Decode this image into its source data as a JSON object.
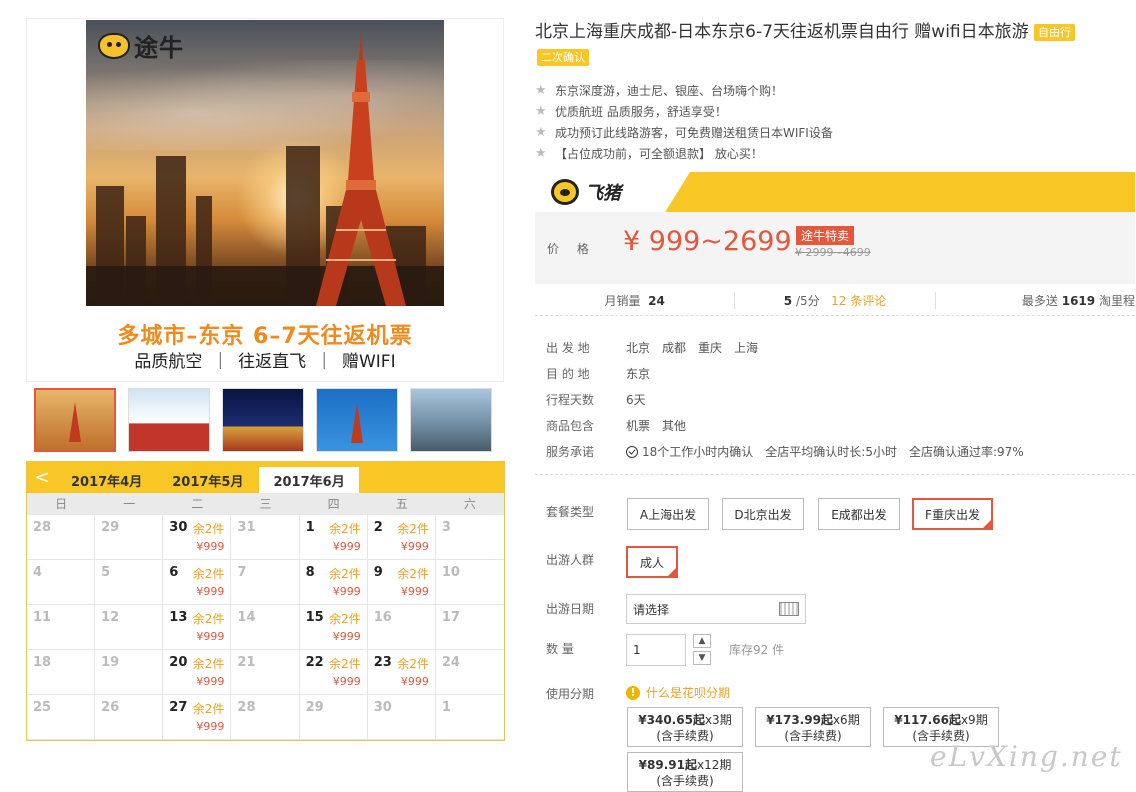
{
  "poster": {
    "logo_text": "途牛",
    "headline": "多城市–东京  6–7天往返机票",
    "subline": "品质航空  ｜  往返直飞  ｜  赠WIFI"
  },
  "calendar": {
    "prev_label": "<",
    "tabs": [
      "2017年4月",
      "2017年5月",
      "2017年6月"
    ],
    "active_tab": "2017年6月",
    "weekdays": [
      "日",
      "一",
      "二",
      "三",
      "四",
      "五",
      "六"
    ],
    "days": [
      {
        "d": "28",
        "stock": "",
        "price": ""
      },
      {
        "d": "29",
        "stock": "",
        "price": ""
      },
      {
        "d": "30",
        "stock": "余2件",
        "price": "¥999"
      },
      {
        "d": "31",
        "stock": "",
        "price": ""
      },
      {
        "d": "1",
        "stock": "余2件",
        "price": "¥999"
      },
      {
        "d": "2",
        "stock": "余2件",
        "price": "¥999"
      },
      {
        "d": "3",
        "stock": "",
        "price": ""
      },
      {
        "d": "4",
        "stock": "",
        "price": ""
      },
      {
        "d": "5",
        "stock": "",
        "price": ""
      },
      {
        "d": "6",
        "stock": "余2件",
        "price": "¥999"
      },
      {
        "d": "7",
        "stock": "",
        "price": ""
      },
      {
        "d": "8",
        "stock": "余2件",
        "price": "¥999"
      },
      {
        "d": "9",
        "stock": "余2件",
        "price": "¥999"
      },
      {
        "d": "10",
        "stock": "",
        "price": ""
      },
      {
        "d": "11",
        "stock": "",
        "price": ""
      },
      {
        "d": "12",
        "stock": "",
        "price": ""
      },
      {
        "d": "13",
        "stock": "余2件",
        "price": "¥999"
      },
      {
        "d": "14",
        "stock": "",
        "price": ""
      },
      {
        "d": "15",
        "stock": "余2件",
        "price": "¥999"
      },
      {
        "d": "16",
        "stock": "",
        "price": ""
      },
      {
        "d": "17",
        "stock": "",
        "price": ""
      },
      {
        "d": "18",
        "stock": "",
        "price": ""
      },
      {
        "d": "19",
        "stock": "",
        "price": ""
      },
      {
        "d": "20",
        "stock": "余2件",
        "price": "¥999"
      },
      {
        "d": "21",
        "stock": "",
        "price": ""
      },
      {
        "d": "22",
        "stock": "余2件",
        "price": "¥999"
      },
      {
        "d": "23",
        "stock": "余2件",
        "price": "¥999"
      },
      {
        "d": "24",
        "stock": "",
        "price": ""
      },
      {
        "d": "25",
        "stock": "",
        "price": ""
      },
      {
        "d": "26",
        "stock": "",
        "price": ""
      },
      {
        "d": "27",
        "stock": "余2件",
        "price": "¥999"
      },
      {
        "d": "28",
        "stock": "",
        "price": ""
      },
      {
        "d": "29",
        "stock": "",
        "price": ""
      },
      {
        "d": "30",
        "stock": "",
        "price": ""
      },
      {
        "d": "1",
        "stock": "",
        "price": ""
      }
    ]
  },
  "product": {
    "title": "北京上海重庆成都-日本东京6-7天往返机票自由行 赠wifi日本旅游",
    "badge_free": "自由行",
    "badge_confirm": "二次确认",
    "features": [
      "东京深度游，迪士尼、银座、台场嗨个购！",
      "优质航班 品质服务，舒适享受！",
      "成功预订此线路游客，可免费赠送租赁日本WIFI设备",
      "【占位成功前，可全额退款】 放心买！"
    ]
  },
  "promo": {
    "brand": "飞猪",
    "price_label": "价 格",
    "price": "¥ 999~2699",
    "tag": "途牛特卖",
    "old_price": "¥ 2999~4699"
  },
  "stats": {
    "sales_label": "月销量",
    "sales_value": "24",
    "rating": "5",
    "rating_suffix": "/5分",
    "reviews": "12 条评论",
    "miles_prefix": "最多送",
    "miles_value": "1619",
    "miles_suffix": "淘里程"
  },
  "details": {
    "departure_label": "出 发 地",
    "departures": [
      "北京",
      "成都",
      "重庆",
      "上海"
    ],
    "destination_label": "目 的 地",
    "destination": "东京",
    "days_label": "行程天数",
    "days": "6天",
    "includes_label": "商品包含",
    "includes": [
      "机票",
      "其他"
    ],
    "promise_label": "服务承诺",
    "promises": [
      "18个工作小时内确认",
      "全店平均确认时长:5小时",
      "全店确认通过率:97%"
    ]
  },
  "options": {
    "package_label": "套餐类型",
    "packages": [
      "A上海出发",
      "D北京出发",
      "E成都出发",
      "F重庆出发"
    ],
    "selected_package": "F重庆出发",
    "crowd_label": "出游人群",
    "crowd": "成人",
    "date_label": "出游日期",
    "date_placeholder": "请选择",
    "qty_label": "数  量",
    "qty_value": "1",
    "qty_up": "▲",
    "qty_down": "▼",
    "stock": "库存92 件",
    "installment_label": "使用分期",
    "huabei_icon": "!",
    "huabei_link": "什么是花呗分期",
    "plans": [
      {
        "amount": "¥340.65起",
        "period": "x3期",
        "fee": "(含手续费)"
      },
      {
        "amount": "¥173.99起",
        "period": "x6期",
        "fee": "(含手续费)"
      },
      {
        "amount": "¥117.66起",
        "period": "x9期",
        "fee": "(含手续费)"
      },
      {
        "amount": "¥89.91起",
        "period": "x12期",
        "fee": "(含手续费)"
      }
    ]
  },
  "watermark": "eLvXing.net",
  "colors": {
    "accent": "#f8c625",
    "price": "#e4573d",
    "highlight": "#f0a020"
  }
}
